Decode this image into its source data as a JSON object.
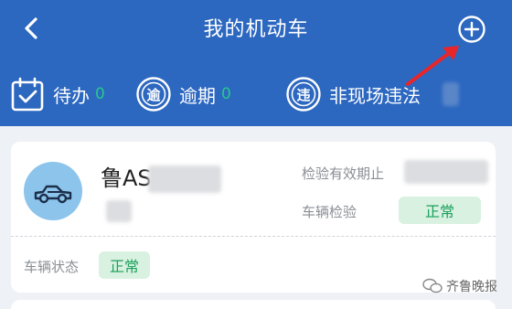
{
  "header": {
    "title": "我的机动车"
  },
  "icons": {
    "back": "chevron-left-icon",
    "add": "plus-circle-icon",
    "arrow": "red-arrow-annotation-icon"
  },
  "stats": [
    {
      "label": "待办",
      "count": "0",
      "icon": "calendar-check-icon"
    },
    {
      "label": "逾期",
      "count": "0",
      "icon": "overdue-circle-icon",
      "icon_char": "逾"
    },
    {
      "label": "非现场违法",
      "icon": "violation-circle-icon",
      "icon_char": "违"
    }
  ],
  "vehicle": {
    "plate": "鲁AS",
    "inspection_expiry_label": "检验有效期止",
    "inspection_label": "车辆检验",
    "inspection_status": "正常",
    "status_label": "车辆状态",
    "status_value": "正常",
    "icon": "car-icon"
  },
  "watermark": {
    "text": "齐鲁晚报"
  },
  "colors": {
    "header_bg": "#2c67c0",
    "count": "#27c88a",
    "badge_bg": "#d9f1e1",
    "badge_text": "#19a05a",
    "avatar_bg": "#8cc4ec"
  }
}
